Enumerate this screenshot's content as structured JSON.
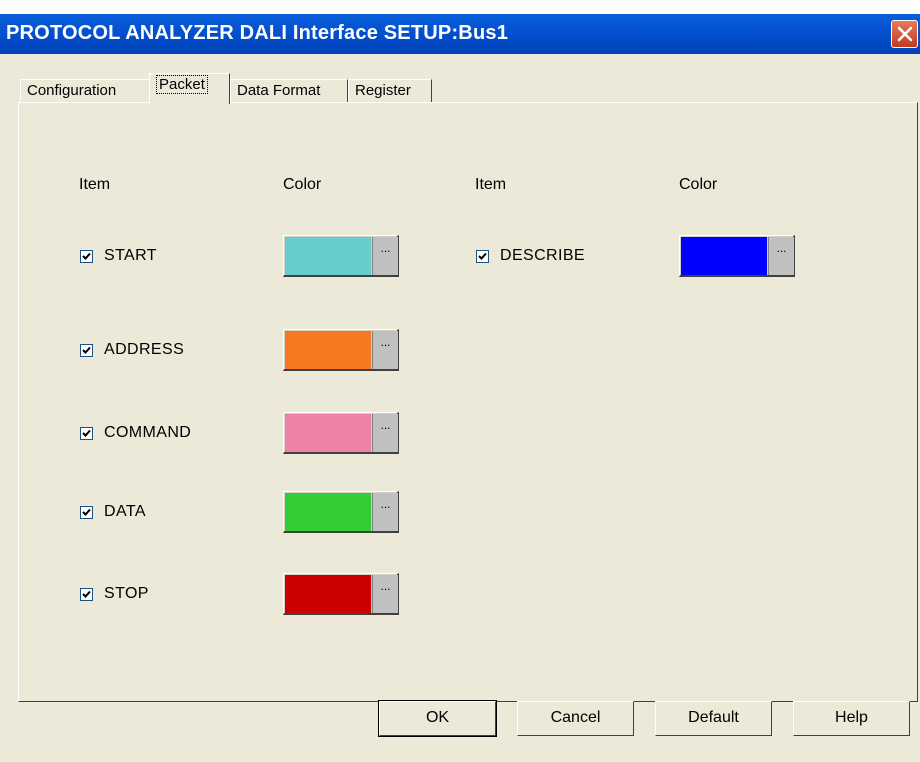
{
  "window": {
    "title": "PROTOCOL ANALYZER DALI Interface SETUP:Bus1"
  },
  "tabs": [
    {
      "label": "Configuration",
      "active": false
    },
    {
      "label": "Packet",
      "active": true
    },
    {
      "label": "Data Format",
      "active": false
    },
    {
      "label": "Register",
      "active": false
    }
  ],
  "headers": {
    "item": "Item",
    "color": "Color"
  },
  "items": [
    {
      "label": "START",
      "checked": true,
      "color": "#66cccc"
    },
    {
      "label": "ADDRESS",
      "checked": true,
      "color": "#f87822"
    },
    {
      "label": "COMMAND",
      "checked": true,
      "color": "#ee82a6"
    },
    {
      "label": "DATA",
      "checked": true,
      "color": "#33cc33"
    },
    {
      "label": "STOP",
      "checked": true,
      "color": "#cc0000"
    },
    {
      "label": "DESCRIBE",
      "checked": true,
      "color": "#0000ff"
    }
  ],
  "color_button_dots": "...",
  "buttons": {
    "ok": "OK",
    "cancel": "Cancel",
    "default": "Default",
    "help": "Help"
  }
}
